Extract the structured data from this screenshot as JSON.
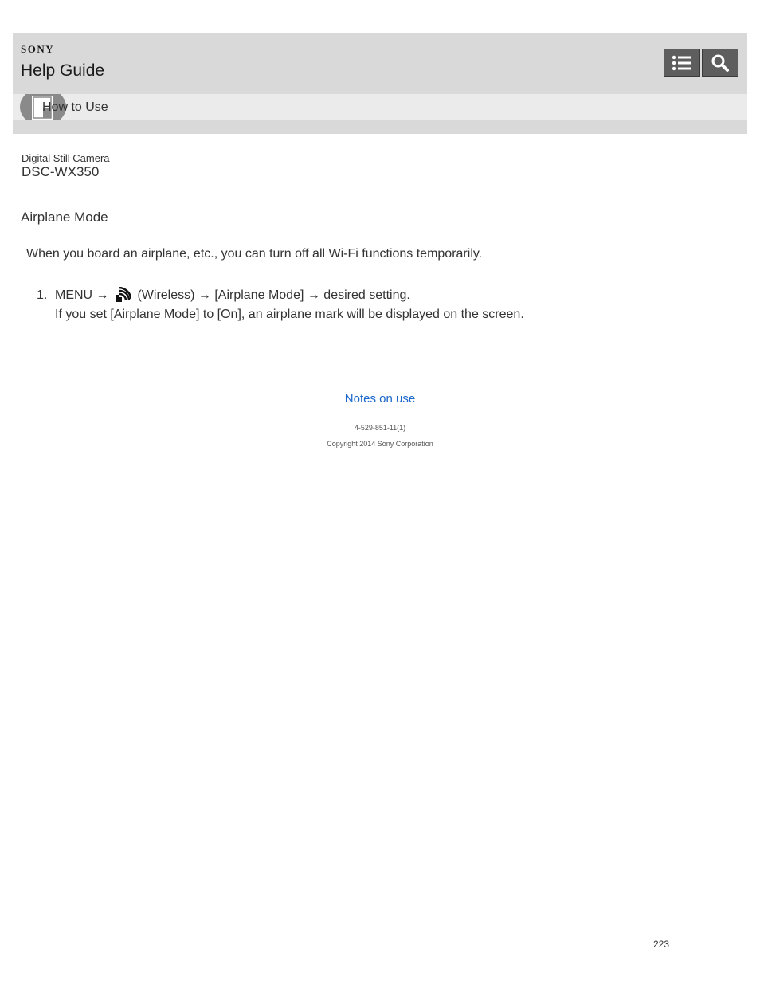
{
  "header": {
    "brand": "SONY",
    "guide_title": "Help Guide",
    "toc_icon": "list-icon",
    "search_icon": "search-icon"
  },
  "category": {
    "icon": "camera-page-icon",
    "label": "How to Use"
  },
  "product": {
    "type": "Digital Still Camera",
    "model": "DSC-WX350"
  },
  "page": {
    "heading": "Airplane Mode",
    "intro": "When you board an airplane, etc., you can turn off all Wi-Fi functions temporarily.",
    "steps": [
      {
        "number": "1.",
        "prefix": "MENU →",
        "icon": "wireless-icon",
        "suffix": "(Wireless) → [Airplane Mode] → desired setting.",
        "note": "If you set [Airplane Mode] to [On], an airplane mark will be displayed on the screen."
      }
    ]
  },
  "footer": {
    "link": "Notes on use",
    "doc_code": "4-529-851-11(1)",
    "copyright": "Copyright 2014 Sony Corporation",
    "page_number": "223"
  },
  "colors": {
    "header_bg": "#d9d9d9",
    "category_bg": "#ebebeb",
    "button_bg": "#5e5e5e",
    "link": "#1a66cc"
  }
}
